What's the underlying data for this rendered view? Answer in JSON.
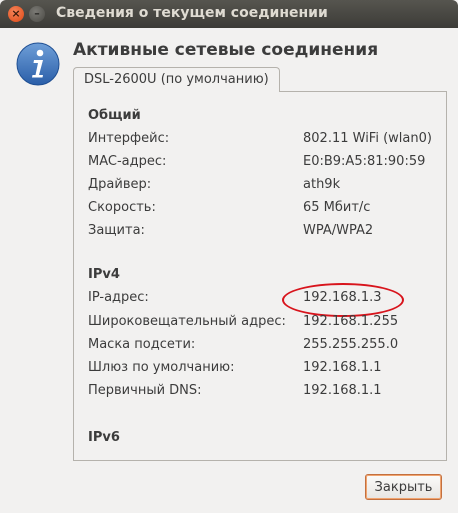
{
  "window": {
    "title": "Сведения о текущем соединении"
  },
  "header": {
    "title": "Активные сетевые соединения",
    "icon": "info-icon"
  },
  "tab": {
    "label": "DSL-2600U (по умолчанию)"
  },
  "general": {
    "title": "Общий",
    "rows": [
      {
        "label": "Интерфейс:",
        "value": "802.11 WiFi (wlan0)"
      },
      {
        "label": "MAC-адрес:",
        "value": "E0:B9:A5:81:90:59"
      },
      {
        "label": "Драйвер:",
        "value": "ath9k"
      },
      {
        "label": "Скорость:",
        "value": "65 Мбит/с"
      },
      {
        "label": "Защита:",
        "value": "WPA/WPA2"
      }
    ]
  },
  "ipv4": {
    "title": "IPv4",
    "rows": [
      {
        "label": "IP-адрес:",
        "value": "192.168.1.3"
      },
      {
        "label": "Широковещательный адрес:",
        "value": "192.168.1.255"
      },
      {
        "label": "Маска подсети:",
        "value": "255.255.255.0"
      },
      {
        "label": "Шлюз по умолчанию:",
        "value": "192.168.1.1"
      },
      {
        "label": "Первичный DNS:",
        "value": "192.168.1.1"
      }
    ]
  },
  "ipv6": {
    "title": "IPv6"
  },
  "buttons": {
    "close_label": "Закрыть"
  },
  "colors": {
    "highlight_ring": "#d8141c",
    "title_bar": "#3c3b37"
  }
}
